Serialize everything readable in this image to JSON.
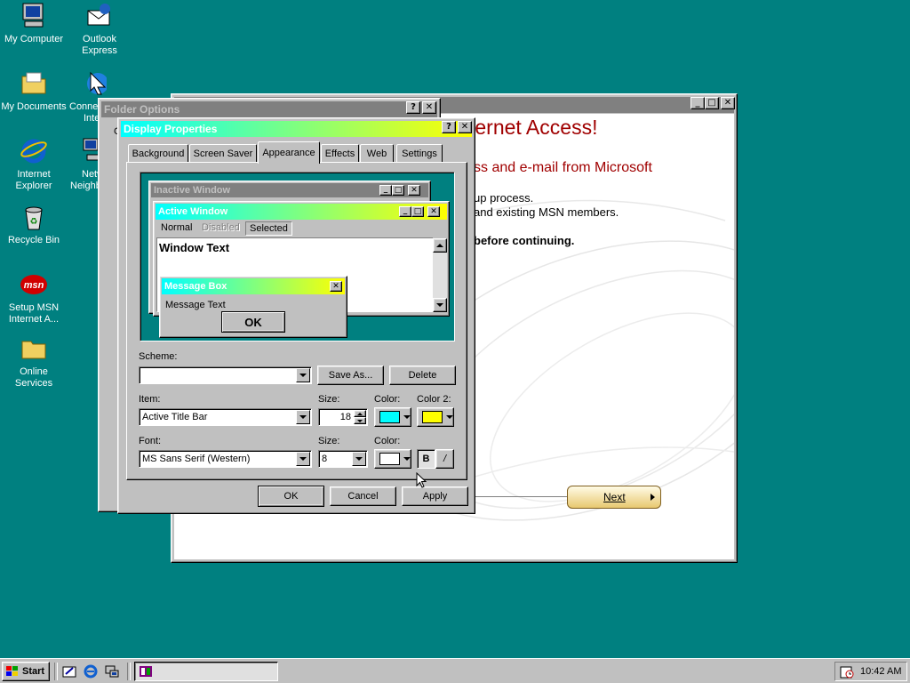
{
  "desktop": {
    "icons": [
      {
        "label_lines": [
          "My Computer"
        ]
      },
      {
        "label_lines": [
          "Outlook",
          "Express"
        ]
      },
      {
        "label_lines": [
          "My Documents"
        ]
      },
      {
        "label_lines": [
          "Connect to the",
          "Internet"
        ]
      },
      {
        "label_lines": [
          "Internet",
          "Explorer"
        ]
      },
      {
        "label_lines": [
          "Network",
          "Neighborhood"
        ]
      },
      {
        "label_lines": [
          "Recycle Bin"
        ]
      },
      {
        "label_lines": [
          "Setup MSN",
          "Internet A..."
        ]
      },
      {
        "label_lines": [
          "Online",
          "Services"
        ]
      }
    ]
  },
  "msn_window": {
    "heading": "ternet Access!",
    "subheading": "ss and e-mail from Microsoft",
    "line1": "up process.",
    "line2": "and existing MSN members.",
    "line3": "before continuing.",
    "next_label": "Next"
  },
  "folder_options": {
    "title": "Folder Options",
    "tab_partial": "G"
  },
  "display_properties": {
    "title": "Display Properties",
    "tabs": [
      "Background",
      "Screen Saver",
      "Appearance",
      "Effects",
      "Web",
      "Settings"
    ],
    "active_tab": "Appearance",
    "preview": {
      "inactive_title": "Inactive Window",
      "active_title": "Active Window",
      "menu": [
        "Normal",
        "Disabled",
        "Selected"
      ],
      "window_text": "Window Text",
      "msgbox_title": "Message Box",
      "msgbox_text": "Message Text",
      "msgbox_ok": "OK"
    },
    "scheme_label": "Scheme:",
    "scheme_value": "",
    "save_as_label": "Save As...",
    "delete_label": "Delete",
    "item_label": "Item:",
    "item_value": "Active Title Bar",
    "size_label": "Size:",
    "item_size": "18",
    "color_label": "Color:",
    "color2_label": "Color 2:",
    "item_color": "#00ffff",
    "item_color2": "#ffff00",
    "font_label": "Font:",
    "font_value": "MS Sans Serif (Western)",
    "font_size_label": "Size:",
    "font_size": "8",
    "font_color_label": "Color:",
    "font_color": "#ffffff",
    "bold_label": "B",
    "italic_label": "/",
    "ok_label": "OK",
    "cancel_label": "Cancel",
    "apply_label": "Apply",
    "title_gradient_start": "#00ffff",
    "title_gradient_end": "#ffff00"
  },
  "taskbar": {
    "start_label": "Start",
    "clock": "10:42 AM"
  }
}
